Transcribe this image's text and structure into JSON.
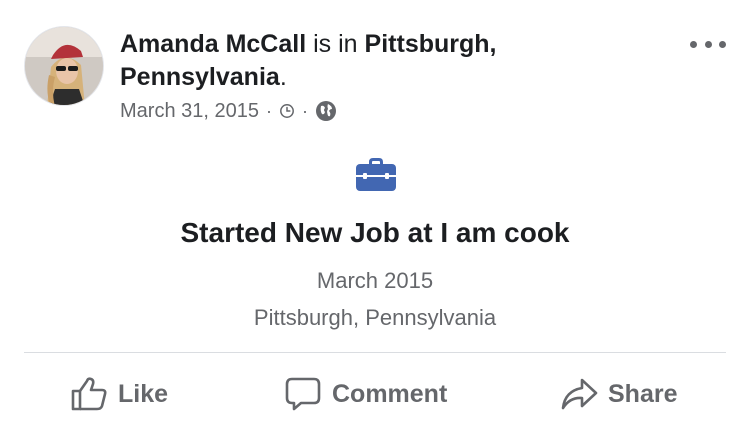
{
  "post": {
    "author": "Amanda McCall",
    "connector": "is in",
    "location_line1": "Pittsburgh,",
    "location_line2": "Pennsylvania",
    "location_suffix": ".",
    "date": "March 31, 2015",
    "separator": "·"
  },
  "icons": {
    "avatar": "profile-photo",
    "clock": "clock-icon",
    "privacy": "globe-icon",
    "more": "more-options-icon",
    "event": "briefcase-icon"
  },
  "life_event": {
    "title": "Started New Job at I am cook",
    "date": "March 2015",
    "place": "Pittsburgh, Pennsylvania"
  },
  "actions": {
    "like": "Like",
    "comment": "Comment",
    "share": "Share"
  },
  "colors": {
    "text_primary": "#1c1e21",
    "text_secondary": "#65676b",
    "briefcase_blue": "#4267b2",
    "divider": "#dadde1"
  }
}
